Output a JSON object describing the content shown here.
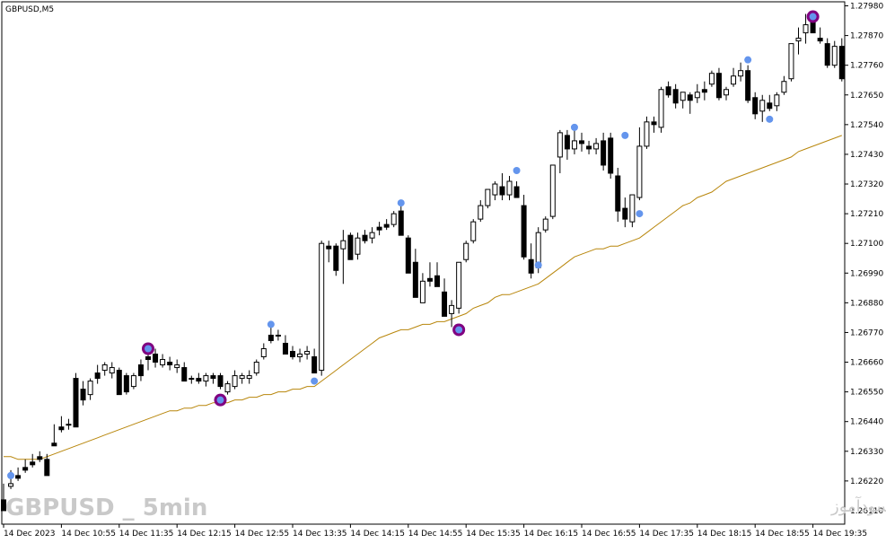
{
  "window": {
    "symbol_title": "GBPUSD,M5"
  },
  "watermark": {
    "left": "GBPUSD _ 5min",
    "right": "انتشار در سایت سودآموز"
  },
  "colors": {
    "background": "#ffffff",
    "candle": "#000000",
    "ma_line": "#b8860b",
    "signal_dot": "#6495ed",
    "signal_ring": "#800080"
  },
  "chart_data": {
    "type": "candlestick",
    "title": "GBPUSD,M5",
    "ylim": [
      1.2606,
      1.27995
    ],
    "price_ticks": [
      "1.27980",
      "1.27870",
      "1.27760",
      "1.27650",
      "1.27540",
      "1.27430",
      "1.27320",
      "1.27210",
      "1.27100",
      "1.26990",
      "1.26880",
      "1.26770",
      "1.26660",
      "1.26550",
      "1.26440",
      "1.26330",
      "1.26220",
      "1.26110"
    ],
    "time_labels": [
      "14 Dec 2023",
      "14 Dec 10:55",
      "14 Dec 11:35",
      "14 Dec 12:15",
      "14 Dec 12:55",
      "14 Dec 13:35",
      "14 Dec 14:15",
      "14 Dec 14:55",
      "14 Dec 15:35",
      "14 Dec 16:15",
      "14 Dec 16:55",
      "14 Dec 17:35",
      "14 Dec 18:15",
      "14 Dec 18:55",
      "14 Dec 19:35"
    ],
    "time_label_candle_index": [
      0,
      8,
      16,
      24,
      32,
      40,
      48,
      56,
      64,
      72,
      80,
      88,
      96,
      104,
      112
    ],
    "candles": [
      [
        1.2615,
        1.2621,
        1.2612,
        1.2611
      ],
      [
        1.262,
        1.2626,
        1.2619,
        1.2621
      ],
      [
        1.2624,
        1.2627,
        1.2622,
        1.2623
      ],
      [
        1.2627,
        1.263,
        1.2625,
        1.2626
      ],
      [
        1.2629,
        1.2632,
        1.2627,
        1.2628
      ],
      [
        1.2631,
        1.2633,
        1.2629,
        1.263
      ],
      [
        1.263,
        1.2632,
        1.2626,
        1.2624
      ],
      [
        1.2636,
        1.2643,
        1.2635,
        1.2635
      ],
      [
        1.2642,
        1.2646,
        1.264,
        1.2641
      ],
      [
        1.2643,
        1.2645,
        1.2641,
        1.2643
      ],
      [
        1.266,
        1.2662,
        1.2642,
        1.2642
      ],
      [
        1.2656,
        1.2659,
        1.265,
        1.2652
      ],
      [
        1.2654,
        1.266,
        1.2652,
        1.2659
      ],
      [
        1.2662,
        1.2665,
        1.2658,
        1.266
      ],
      [
        1.2663,
        1.2666,
        1.2661,
        1.2665
      ],
      [
        1.2662,
        1.2666,
        1.266,
        1.2664
      ],
      [
        1.2663,
        1.2664,
        1.2655,
        1.2654
      ],
      [
        1.2661,
        1.2662,
        1.2654,
        1.2655
      ],
      [
        1.2657,
        1.2662,
        1.2656,
        1.2661
      ],
      [
        1.2665,
        1.2667,
        1.2659,
        1.2661
      ],
      [
        1.2668,
        1.2673,
        1.2663,
        1.2667
      ],
      [
        1.2669,
        1.2671,
        1.2664,
        1.2666
      ],
      [
        1.2665,
        1.2669,
        1.2664,
        1.2667
      ],
      [
        1.2666,
        1.2668,
        1.2663,
        1.2665
      ],
      [
        1.2664,
        1.2667,
        1.2662,
        1.2665
      ],
      [
        1.2664,
        1.2666,
        1.2659,
        1.2659
      ],
      [
        1.266,
        1.2661,
        1.2658,
        1.266
      ],
      [
        1.266,
        1.2662,
        1.2658,
        1.2659
      ],
      [
        1.2659,
        1.2662,
        1.2657,
        1.2661
      ],
      [
        1.2661,
        1.2662,
        1.2658,
        1.266
      ],
      [
        1.2661,
        1.2662,
        1.2656,
        1.2657
      ],
      [
        1.2655,
        1.2659,
        1.2654,
        1.2658
      ],
      [
        1.2657,
        1.2663,
        1.2656,
        1.2661
      ],
      [
        1.266,
        1.2662,
        1.2658,
        1.2661
      ],
      [
        1.266,
        1.2663,
        1.2658,
        1.2661
      ],
      [
        1.2662,
        1.2667,
        1.2661,
        1.2666
      ],
      [
        1.2668,
        1.2673,
        1.2667,
        1.2671
      ],
      [
        1.2676,
        1.2679,
        1.2673,
        1.2674
      ],
      [
        1.2676,
        1.2678,
        1.2674,
        1.2676
      ],
      [
        1.2673,
        1.2676,
        1.2669,
        1.2669
      ],
      [
        1.267,
        1.2672,
        1.2667,
        1.2668
      ],
      [
        1.2668,
        1.2671,
        1.2666,
        1.2669
      ],
      [
        1.2669,
        1.2672,
        1.2667,
        1.267
      ],
      [
        1.2668,
        1.2671,
        1.2662,
        1.2662
      ],
      [
        1.2663,
        1.2711,
        1.2661,
        1.271
      ],
      [
        1.2709,
        1.2711,
        1.2703,
        1.2708
      ],
      [
        1.2709,
        1.271,
        1.2698,
        1.27
      ],
      [
        1.2708,
        1.2715,
        1.2695,
        1.2711
      ],
      [
        1.2713,
        1.2714,
        1.2705,
        1.2704
      ],
      [
        1.2706,
        1.2714,
        1.2704,
        1.2712
      ],
      [
        1.2713,
        1.2715,
        1.271,
        1.2711
      ],
      [
        1.2712,
        1.2716,
        1.271,
        1.2714
      ],
      [
        1.2716,
        1.2718,
        1.2713,
        1.2715
      ],
      [
        1.2717,
        1.2719,
        1.2715,
        1.2716
      ],
      [
        1.2717,
        1.2722,
        1.2716,
        1.2721
      ],
      [
        1.2722,
        1.2724,
        1.2713,
        1.2713
      ],
      [
        1.2712,
        1.2713,
        1.2699,
        1.2699
      ],
      [
        1.2703,
        1.2708,
        1.269,
        1.269
      ],
      [
        1.2688,
        1.2699,
        1.2688,
        1.2696
      ],
      [
        1.2697,
        1.2703,
        1.2694,
        1.2696
      ],
      [
        1.2698,
        1.2703,
        1.2694,
        1.2694
      ],
      [
        1.2692,
        1.2697,
        1.2683,
        1.2683
      ],
      [
        1.2684,
        1.2689,
        1.2679,
        1.2687
      ],
      [
        1.2686,
        1.2703,
        1.2684,
        1.2703
      ],
      [
        1.2704,
        1.2711,
        1.2703,
        1.271
      ],
      [
        1.2711,
        1.2719,
        1.271,
        1.2718
      ],
      [
        1.2719,
        1.2726,
        1.2718,
        1.2724
      ],
      [
        1.2724,
        1.273,
        1.2723,
        1.273
      ],
      [
        1.2728,
        1.2733,
        1.2726,
        1.2732
      ],
      [
        1.2731,
        1.2736,
        1.2726,
        1.2728
      ],
      [
        1.2728,
        1.2735,
        1.2726,
        1.2733
      ],
      [
        1.2731,
        1.2733,
        1.2727,
        1.2727
      ],
      [
        1.2724,
        1.2728,
        1.2704,
        1.2705
      ],
      [
        1.2704,
        1.271,
        1.2697,
        1.2699
      ],
      [
        1.2701,
        1.2716,
        1.2699,
        1.2714
      ],
      [
        1.2715,
        1.272,
        1.2714,
        1.2719
      ],
      [
        1.272,
        1.2739,
        1.2719,
        1.2739
      ],
      [
        1.2742,
        1.2752,
        1.2736,
        1.2751
      ],
      [
        1.275,
        1.2752,
        1.2741,
        1.2745
      ],
      [
        1.2745,
        1.2752,
        1.2743,
        1.2748
      ],
      [
        1.2748,
        1.2751,
        1.2744,
        1.2747
      ],
      [
        1.2746,
        1.2748,
        1.2743,
        1.2745
      ],
      [
        1.2745,
        1.2749,
        1.2743,
        1.2747
      ],
      [
        1.2748,
        1.2751,
        1.2737,
        1.2739
      ],
      [
        1.2749,
        1.2751,
        1.2734,
        1.2736
      ],
      [
        1.2735,
        1.2738,
        1.2718,
        1.2722
      ],
      [
        1.2723,
        1.2727,
        1.2716,
        1.2719
      ],
      [
        1.2718,
        1.2728,
        1.2716,
        1.2728
      ],
      [
        1.2727,
        1.2753,
        1.2726,
        1.2746
      ],
      [
        1.2746,
        1.2757,
        1.2745,
        1.2755
      ],
      [
        1.2755,
        1.2757,
        1.2751,
        1.2754
      ],
      [
        1.2753,
        1.2768,
        1.2751,
        1.2767
      ],
      [
        1.2768,
        1.277,
        1.2764,
        1.2765
      ],
      [
        1.2767,
        1.2769,
        1.276,
        1.2762
      ],
      [
        1.2763,
        1.2766,
        1.276,
        1.2766
      ],
      [
        1.2765,
        1.2766,
        1.2758,
        1.2763
      ],
      [
        1.2764,
        1.2769,
        1.2762,
        1.2766
      ],
      [
        1.2767,
        1.277,
        1.2763,
        1.2766
      ],
      [
        1.2769,
        1.2774,
        1.2768,
        1.2773
      ],
      [
        1.2773,
        1.2775,
        1.2763,
        1.2764
      ],
      [
        1.2765,
        1.2768,
        1.2763,
        1.2767
      ],
      [
        1.2769,
        1.2775,
        1.2768,
        1.2772
      ],
      [
        1.2772,
        1.2777,
        1.277,
        1.2774
      ],
      [
        1.2774,
        1.2776,
        1.2762,
        1.2763
      ],
      [
        1.2764,
        1.2766,
        1.2756,
        1.2758
      ],
      [
        1.2759,
        1.2765,
        1.2755,
        1.2763
      ],
      [
        1.2762,
        1.2765,
        1.2759,
        1.276
      ],
      [
        1.2761,
        1.2766,
        1.2759,
        1.2765
      ],
      [
        1.2766,
        1.2772,
        1.2765,
        1.277
      ],
      [
        1.2771,
        1.2784,
        1.277,
        1.2784
      ],
      [
        1.2785,
        1.279,
        1.278,
        1.2786
      ],
      [
        1.2788,
        1.2795,
        1.2784,
        1.2791
      ],
      [
        1.2794,
        1.2796,
        1.2788,
        1.2788
      ],
      [
        1.2786,
        1.279,
        1.2784,
        1.2785
      ],
      [
        1.2784,
        1.2786,
        1.2775,
        1.2776
      ],
      [
        1.2776,
        1.2785,
        1.2775,
        1.2783
      ],
      [
        1.2783,
        1.2786,
        1.277,
        1.2771
      ]
    ],
    "ma_series": [
      1.2631,
      1.2631,
      1.263,
      1.263,
      1.263,
      1.263,
      1.2631,
      1.2632,
      1.2633,
      1.2634,
      1.2635,
      1.2636,
      1.2637,
      1.2638,
      1.2639,
      1.264,
      1.2641,
      1.2642,
      1.2643,
      1.2644,
      1.2645,
      1.2646,
      1.2647,
      1.2648,
      1.2648,
      1.2649,
      1.2649,
      1.265,
      1.265,
      1.2651,
      1.2651,
      1.2651,
      1.2652,
      1.2652,
      1.2653,
      1.2653,
      1.2654,
      1.2654,
      1.2655,
      1.2655,
      1.2656,
      1.2656,
      1.2657,
      1.2657,
      1.2659,
      1.2661,
      1.2663,
      1.2665,
      1.2667,
      1.2669,
      1.2671,
      1.2673,
      1.2675,
      1.2676,
      1.2677,
      1.2678,
      1.2678,
      1.2679,
      1.268,
      1.268,
      1.2681,
      1.2681,
      1.2682,
      1.2683,
      1.2684,
      1.2686,
      1.2687,
      1.2688,
      1.269,
      1.2691,
      1.2691,
      1.2692,
      1.2693,
      1.2694,
      1.2695,
      1.2697,
      1.2699,
      1.2701,
      1.2703,
      1.2705,
      1.2706,
      1.2707,
      1.2708,
      1.2708,
      1.2709,
      1.2709,
      1.271,
      1.2711,
      1.2712,
      1.2714,
      1.2716,
      1.2718,
      1.272,
      1.2722,
      1.2724,
      1.2725,
      1.2727,
      1.2728,
      1.2729,
      1.2731,
      1.2733,
      1.2734,
      1.2735,
      1.2736,
      1.2737,
      1.2738,
      1.2739,
      1.274,
      1.2741,
      1.2742,
      1.2744,
      1.2745,
      1.2746,
      1.2747,
      1.2748,
      1.2749,
      1.275
    ],
    "signals": [
      {
        "candle": 1,
        "price": 1.2624,
        "ring": false
      },
      {
        "candle": 20,
        "price": 1.2671,
        "ring": true
      },
      {
        "candle": 30,
        "price": 1.2652,
        "ring": true
      },
      {
        "candle": 37,
        "price": 1.268,
        "ring": false
      },
      {
        "candle": 43,
        "price": 1.2659,
        "ring": false
      },
      {
        "candle": 55,
        "price": 1.2725,
        "ring": false
      },
      {
        "candle": 63,
        "price": 1.2678,
        "ring": true
      },
      {
        "candle": 71,
        "price": 1.2737,
        "ring": false
      },
      {
        "candle": 74,
        "price": 1.2702,
        "ring": false
      },
      {
        "candle": 79,
        "price": 1.2753,
        "ring": false
      },
      {
        "candle": 86,
        "price": 1.275,
        "ring": false
      },
      {
        "candle": 88,
        "price": 1.2721,
        "ring": false
      },
      {
        "candle": 103,
        "price": 1.2778,
        "ring": false
      },
      {
        "candle": 106,
        "price": 1.2756,
        "ring": false
      },
      {
        "candle": 112,
        "price": 1.2794,
        "ring": true
      }
    ]
  }
}
